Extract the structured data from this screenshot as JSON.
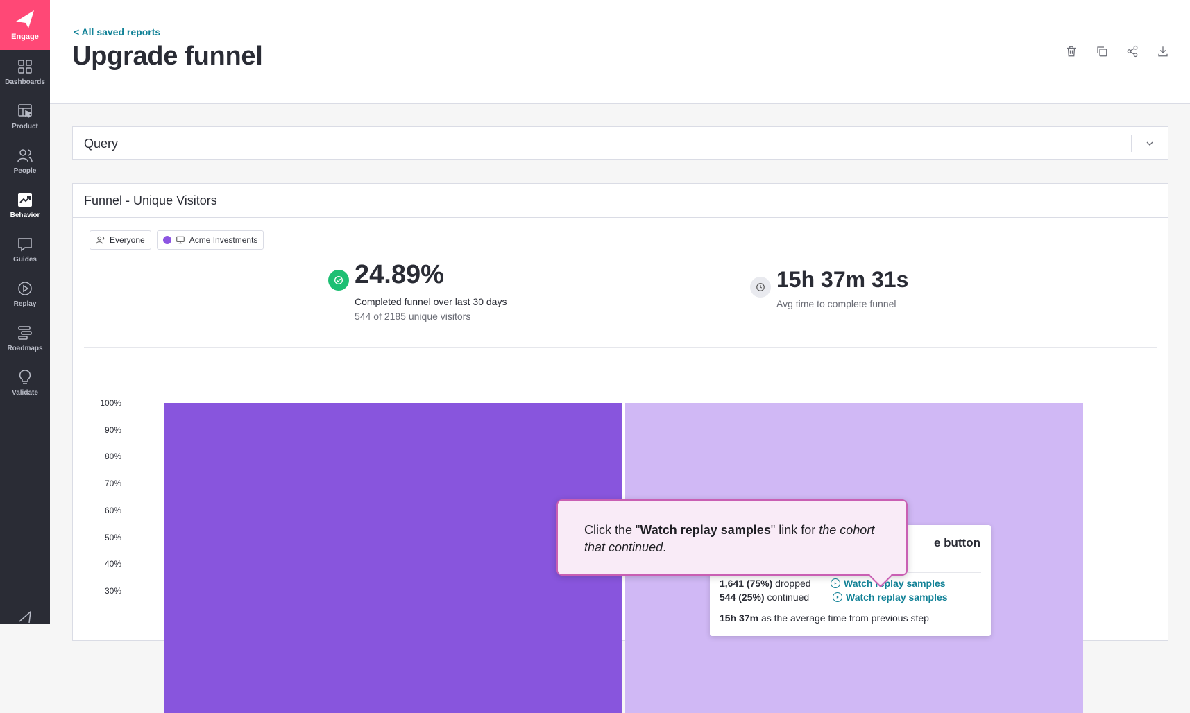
{
  "sidebar": {
    "brand": {
      "label": "Engage",
      "icon": "engage-arrow-icon"
    },
    "items": [
      {
        "label": "Dashboards",
        "icon": "grid-icon",
        "active": false
      },
      {
        "label": "Product",
        "icon": "layout-cursor-icon",
        "active": false
      },
      {
        "label": "People",
        "icon": "people-icon",
        "active": false
      },
      {
        "label": "Behavior",
        "icon": "trend-chart-icon",
        "active": true
      },
      {
        "label": "Guides",
        "icon": "message-icon",
        "active": false
      },
      {
        "label": "Replay",
        "icon": "play-circle-icon",
        "active": false
      },
      {
        "label": "Roadmaps",
        "icon": "roadmap-icon",
        "active": false
      },
      {
        "label": "Validate",
        "icon": "lightbulb-icon",
        "active": false
      }
    ]
  },
  "header": {
    "back_link": "< All saved reports",
    "title": "Upgrade funnel",
    "actions": [
      "trash-icon",
      "duplicate-icon",
      "share-icon",
      "download-icon"
    ]
  },
  "query": {
    "title": "Query"
  },
  "funnel": {
    "title": "Funnel - Unique Visitors",
    "segment_chip": "Everyone",
    "app_chip": "Acme Investments",
    "app_color": "#8c55e2",
    "completion": {
      "value": "24.89%",
      "label": "Completed funnel over last 30 days",
      "detail": "544 of 2185 unique visitors"
    },
    "avg_time": {
      "value": "15h 37m 31s",
      "label": "Avg time to complete funnel"
    }
  },
  "chart_data": {
    "type": "bar",
    "y_ticks": [
      "100%",
      "90%",
      "80%",
      "70%",
      "60%",
      "50%",
      "40%",
      "30%"
    ],
    "ylim": [
      0,
      100
    ],
    "bars": [
      {
        "value": 100,
        "color": "#8855dd"
      },
      {
        "value": 100,
        "color": "#d0b8f5"
      }
    ]
  },
  "step_popover": {
    "title_fragment": "e button",
    "dropped": {
      "count": "1,641 (75%)",
      "label": "dropped"
    },
    "continued": {
      "count": "544 (25%)",
      "label": "continued"
    },
    "avg_time": {
      "value": "15h 37m",
      "label": "as the average time from previous step"
    },
    "watch_label": "Watch replay samples"
  },
  "guide": {
    "text_prefix": "Click the \"",
    "text_bold": "Watch replay samples",
    "text_mid": "\" link for ",
    "text_italic": "the cohort that continued",
    "text_suffix": "."
  }
}
